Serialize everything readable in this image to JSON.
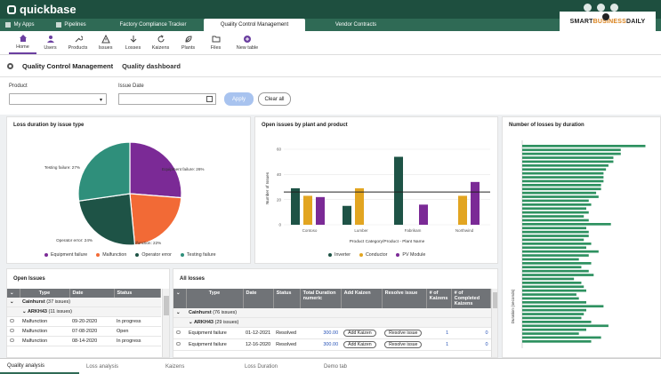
{
  "app": {
    "name": "quickbase"
  },
  "navbar": {
    "tabs": [
      {
        "label": "My Apps",
        "active": false
      },
      {
        "label": "Pipelines",
        "active": false
      },
      {
        "label": "Factory Compliance Tracker",
        "active": false
      },
      {
        "label": "Quality Control Management",
        "active": true
      },
      {
        "label": "Vendor Contracts",
        "active": false
      }
    ]
  },
  "sponsor": {
    "pre": "SMART",
    "mid": "BUSINESS",
    "post": "DAILY"
  },
  "toolbar": {
    "items": [
      {
        "label": "Home",
        "icon": "home-icon"
      },
      {
        "label": "Users",
        "icon": "user-icon"
      },
      {
        "label": "Products",
        "icon": "wrench-icon"
      },
      {
        "label": "Issues",
        "icon": "warning-icon"
      },
      {
        "label": "Losses",
        "icon": "arrow-down-icon"
      },
      {
        "label": "Kaizens",
        "icon": "refresh-icon"
      },
      {
        "label": "Plants",
        "icon": "leaf-icon"
      },
      {
        "label": "Files",
        "icon": "folder-icon"
      },
      {
        "label": "New table",
        "icon": "plus-circle-icon"
      }
    ]
  },
  "page": {
    "app_title": "Quality Control Management",
    "dashboard_title": "Quality dashboard"
  },
  "filters": {
    "product_label": "Product",
    "issue_date_label": "Issue Date",
    "apply_label": "Apply",
    "clear_label": "Clear all"
  },
  "loss_chart": {
    "title": "Loss duration by issue type",
    "legend": [
      "Equipment failure",
      "Malfunction",
      "Operator error",
      "Testing failure"
    ]
  },
  "plant_chart": {
    "title": "Open issues by plant and product",
    "xlabel": "Product Category/Product - Plant Name",
    "ylabel": "Number of Issues",
    "legend": [
      "Inverter",
      "Conductor",
      "PV Module"
    ]
  },
  "duration_chart": {
    "title": "Number of losses by duration",
    "ylabel": "Duration (seconds)"
  },
  "chart_data": [
    {
      "type": "pie",
      "title": "Loss duration by issue type",
      "labels": [
        "Equipment failure",
        "Malfunction",
        "Operator error",
        "Testing failure"
      ],
      "values": [
        26,
        22,
        24,
        27
      ],
      "slice_labels": [
        "Equipment failure: 26%",
        "Malfunction: 22%",
        "Operator error: 24%",
        "Testing failure: 27%"
      ],
      "colors": [
        "#7b2a96",
        "#f26a36",
        "#1e5346",
        "#2f8f7b"
      ]
    },
    {
      "type": "bar",
      "title": "Open issues by plant and product",
      "categories": [
        "Contoso",
        "Lumber",
        "Fabrikam",
        "Northwind"
      ],
      "series": [
        {
          "name": "Inverter",
          "values": [
            29,
            15,
            54,
            0
          ],
          "color": "#1e5346"
        },
        {
          "name": "Conductor",
          "values": [
            23,
            29,
            0,
            23
          ],
          "color": "#e2a521"
        },
        {
          "name": "PV Module",
          "values": [
            22,
            0,
            16,
            34
          ],
          "color": "#7b2a96"
        }
      ],
      "reference_line": 26,
      "ylim": [
        0,
        60
      ],
      "yticks": [
        0,
        20,
        40,
        60
      ],
      "xlabel": "Product Category/Product - Plant Name",
      "ylabel": "Number of Issues"
    },
    {
      "type": "bar",
      "orientation": "horizontal",
      "title": "Number of losses by duration",
      "ylabel": "Duration (seconds)",
      "values": [
        5,
        4,
        4,
        3.7,
        3.7,
        3.5,
        3.4,
        3.3,
        3.3,
        3.3,
        3.2,
        3.2,
        3.0,
        3.1,
        2.7,
        2.8,
        2.6,
        2.7,
        2.5,
        2.7,
        3.6,
        2.6,
        2.7,
        2.7,
        2.5,
        2.8,
        2.6,
        3.1,
        2.7,
        2.3,
        2.8,
        2.4,
        2.7,
        2.9,
        2.1,
        2.4,
        2.5,
        2.6,
        2.2,
        2.3,
        2.6,
        3.3,
        2.6,
        2.5,
        2.4,
        2.8,
        3.5,
        2.6,
        2.3,
        3.2,
        2.8
      ]
    }
  ],
  "open_issues": {
    "title": "Open Issues",
    "columns": [
      "Type",
      "Date",
      "Status"
    ],
    "groups": [
      {
        "label": "Cainhurst",
        "count": "(37 issues)"
      }
    ],
    "subgroups": [
      {
        "label": "ARKH43",
        "count": "(11 issues)"
      }
    ],
    "rows": [
      {
        "type": "Malfunction",
        "date": "09-20-2020",
        "status": "In progress"
      },
      {
        "type": "Malfunction",
        "date": "07-08-2020",
        "status": "Open"
      },
      {
        "type": "Malfunction",
        "date": "08-14-2020",
        "status": "In progress"
      }
    ]
  },
  "all_losses": {
    "title": "All losses",
    "columns": [
      "Type",
      "Date",
      "Status",
      "Total Duration numeric",
      "Add Kaizen",
      "Resolve issue",
      "# of Kaizens",
      "# of Completed Kaizens"
    ],
    "groups": [
      {
        "label": "Cainhurst",
        "count": "(76 issues)"
      }
    ],
    "subgroups": [
      {
        "label": "ARKH43",
        "count": "(29 issues)"
      }
    ],
    "rows": [
      {
        "type": "Equipment failure",
        "date": "01-12-2021",
        "status": "Resolved",
        "duration": "300.00",
        "add_kaizen": "Add Kaizen",
        "resolve": "Resolve issue",
        "kaizens": "1",
        "completed": "0"
      },
      {
        "type": "Equipment failure",
        "date": "12-16-2020",
        "status": "Resolved",
        "duration": "300.00",
        "add_kaizen": "Add Kaizen",
        "resolve": "Resolve issue",
        "kaizens": "1",
        "completed": "0"
      }
    ]
  },
  "bottom_tabs": [
    {
      "label": "Quality analysis",
      "active": true
    },
    {
      "label": "Loss analysis",
      "active": false
    },
    {
      "label": "Kaizens",
      "active": false
    },
    {
      "label": "Loss Duration",
      "active": false
    },
    {
      "label": "Demo tab",
      "active": false
    }
  ]
}
